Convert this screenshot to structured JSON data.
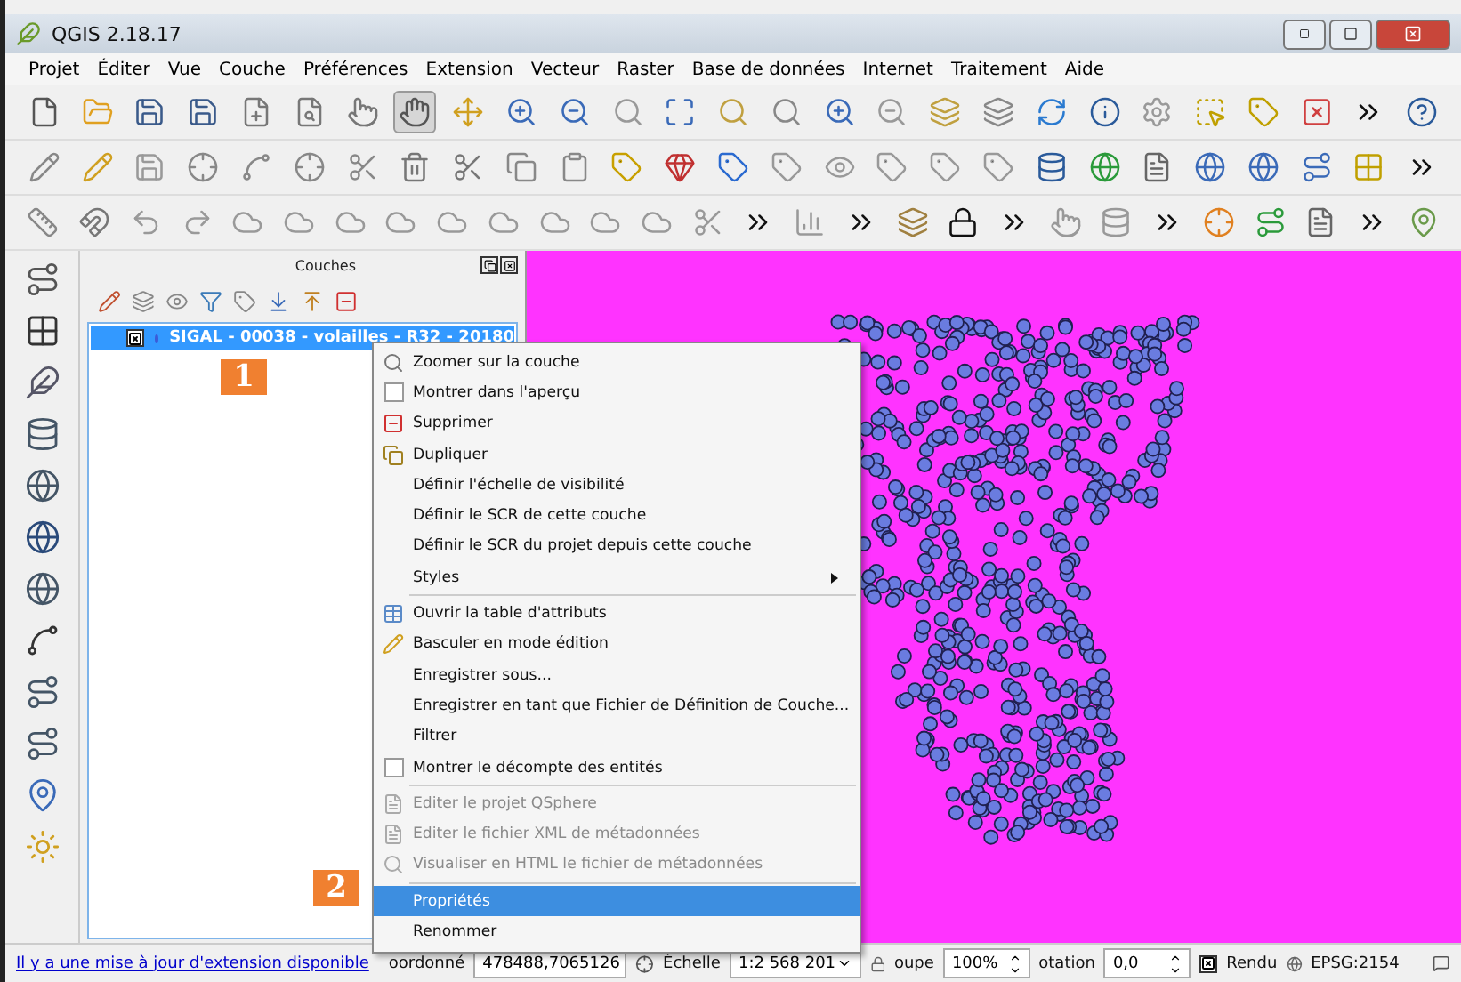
{
  "window": {
    "title": "QGIS 2.18.17"
  },
  "menu_bar": [
    "Projet",
    "Éditer",
    "Vue",
    "Couche",
    "Préférences",
    "Extension",
    "Vecteur",
    "Raster",
    "Base de données",
    "Internet",
    "Traitement",
    "Aide"
  ],
  "pan_tool": {
    "selected": true
  },
  "layers_panel": {
    "title": "Couches",
    "layers": [
      {
        "name": "SIGAL - 00038 - volailles - R32 - 20180",
        "visible": true,
        "selected": true
      }
    ]
  },
  "context_menu": [
    {
      "kind": "zoom",
      "label": "Zoomer sur la couche",
      "disabled": false,
      "selected": false
    },
    {
      "kind": "check",
      "label": "Montrer dans l'aperçu",
      "checked": false,
      "disabled": false,
      "selected": false
    },
    {
      "kind": "remove",
      "label": "Supprimer",
      "disabled": false,
      "selected": false
    },
    {
      "kind": "duplicate",
      "label": "Dupliquer",
      "disabled": false,
      "selected": false
    },
    {
      "kind": "plain",
      "label": "Définir l'échelle de visibilité",
      "disabled": false,
      "selected": false
    },
    {
      "kind": "plain",
      "label": "Définir le SCR de cette couche",
      "disabled": false,
      "selected": false
    },
    {
      "kind": "plain",
      "label": "Définir le SCR du projet depuis cette couche",
      "disabled": false,
      "selected": false
    },
    {
      "kind": "submenu",
      "label": "Styles",
      "disabled": false,
      "selected": false
    },
    {
      "kind": "separator"
    },
    {
      "kind": "table",
      "label": "Ouvrir la table d'attributs",
      "disabled": false,
      "selected": false
    },
    {
      "kind": "edit",
      "label": "Basculer en mode édition",
      "disabled": false,
      "selected": false
    },
    {
      "kind": "plain",
      "label": "Enregistrer sous...",
      "disabled": false,
      "selected": false
    },
    {
      "kind": "plain",
      "label": "Enregistrer en tant que Fichier de Définition de Couche...",
      "disabled": false,
      "selected": false
    },
    {
      "kind": "plain",
      "label": "Filtrer",
      "disabled": false,
      "selected": false
    },
    {
      "kind": "check",
      "label": "Montrer le décompte des entités",
      "checked": false,
      "disabled": false,
      "selected": false
    },
    {
      "kind": "separator"
    },
    {
      "kind": "doc",
      "label": "Editer le projet QSphere",
      "disabled": true,
      "selected": false
    },
    {
      "kind": "doc",
      "label": "Editer le fichier XML de métadonnées",
      "disabled": true,
      "selected": false
    },
    {
      "kind": "view",
      "label": "Visualiser en HTML le fichier de métadonnées",
      "disabled": true,
      "selected": false
    },
    {
      "kind": "separator"
    },
    {
      "kind": "plain",
      "label": "Propriétés",
      "disabled": false,
      "selected": true
    },
    {
      "kind": "plain",
      "label": "Renommer",
      "disabled": false,
      "selected": false
    }
  ],
  "step_badges": [
    "1",
    "2"
  ],
  "status_bar": {
    "update_link": "Il y a une mise à jour d'extension disponible",
    "coordinate_label": "oordonné",
    "coordinate": "478488,7065126",
    "scale_label": "Échelle",
    "scale": "1:2 568 201",
    "magnifier_label": "oupe",
    "magnifier": "100%",
    "rotation_label": "otation",
    "rotation": "0,0",
    "render_label": "Rendu",
    "render_checked": true,
    "crs": "EPSG:2154"
  }
}
